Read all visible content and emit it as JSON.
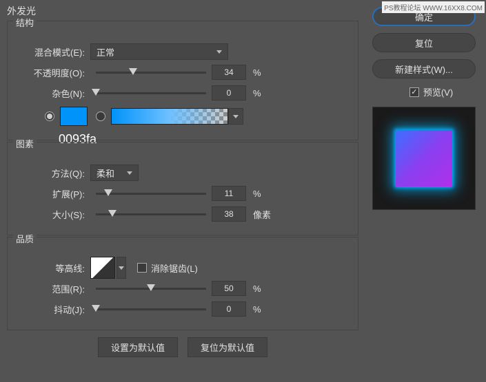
{
  "watermark": "PS教程论坛 WWW.16XX8.COM",
  "title": "外发光",
  "sections": {
    "structure": "结构",
    "elements": "图素",
    "quality": "品质"
  },
  "labels": {
    "blendMode": "混合模式(E):",
    "opacity": "不透明度(O):",
    "noise": "杂色(N):",
    "method": "方法(Q):",
    "spread": "扩展(P):",
    "size": "大小(S):",
    "contour": "等高线:",
    "antialias": "消除锯齿(L)",
    "range": "范围(R):",
    "jitter": "抖动(J):"
  },
  "values": {
    "blendMode": "正常",
    "opacity": "34",
    "noise": "0",
    "method": "柔和",
    "spread": "11",
    "size": "38",
    "range": "50",
    "jitter": "0"
  },
  "units": {
    "percent": "%",
    "pixels": "像素"
  },
  "color": {
    "hex": "0093fa"
  },
  "buttons": {
    "setDefault": "设置为默认值",
    "resetDefault": "复位为默认值",
    "ok": "确定",
    "reset": "复位",
    "newStyle": "新建样式(W)...",
    "preview": "预览(V)"
  }
}
